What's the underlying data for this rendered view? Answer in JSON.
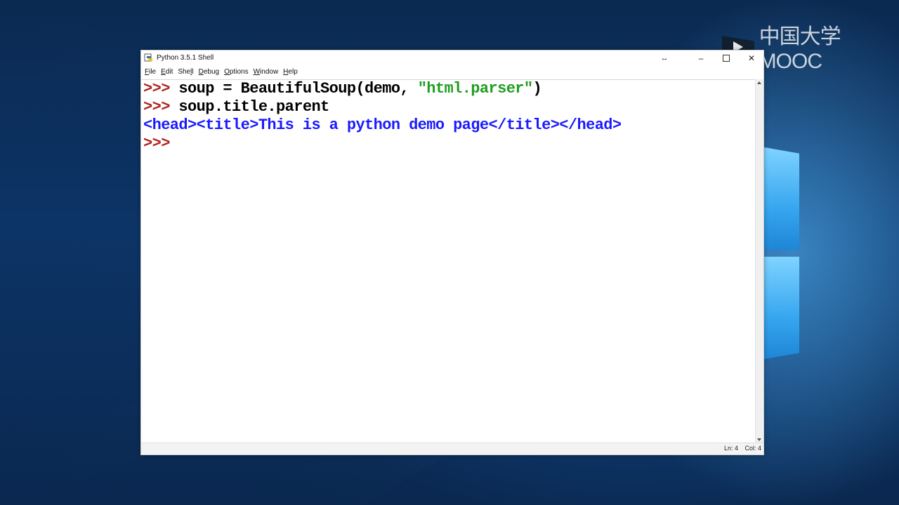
{
  "window": {
    "title": "Python 3.5.1 Shell",
    "buttons": {
      "extra": "↔",
      "minimize": "–",
      "close": "✕"
    }
  },
  "menu": [
    {
      "underline": "F",
      "rest": "ile"
    },
    {
      "underline": "E",
      "rest": "dit"
    },
    {
      "pre": "She",
      "underline": "l",
      "rest": "l"
    },
    {
      "underline": "D",
      "rest": "ebug"
    },
    {
      "underline": "O",
      "rest": "ptions"
    },
    {
      "underline": "W",
      "rest": "indow"
    },
    {
      "underline": "H",
      "rest": "elp"
    }
  ],
  "shell": {
    "prompt": ">>>",
    "line1_code": " soup = BeautifulSoup(demo, ",
    "line1_string": "\"html.parser\"",
    "line1_end": ")",
    "line2_code": " soup.title.parent",
    "output": "<head><title>This is a python demo page</title></head>"
  },
  "status": {
    "line": "Ln: 4",
    "col": "Col: 4"
  },
  "watermark": {
    "text": "中国大学MOOC"
  },
  "colors": {
    "prompt": "#b22222",
    "string": "#1f9e1f",
    "output": "#1a1aff"
  },
  "icons": [
    "python-idle-icon",
    "resize-arrows-icon",
    "minimize-icon",
    "maximize-icon",
    "close-icon",
    "scroll-up-icon",
    "scroll-down-icon",
    "mooc-logo-icon"
  ]
}
